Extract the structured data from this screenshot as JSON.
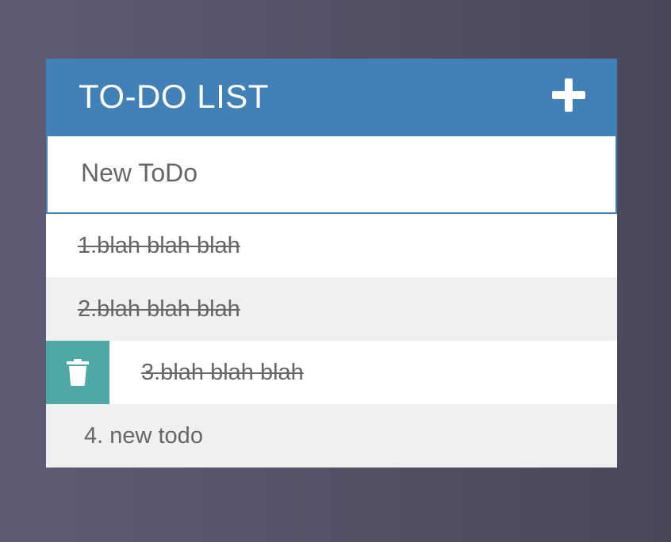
{
  "header": {
    "title": "TO-DO LIST",
    "add_icon": "plus-icon"
  },
  "new_todo": {
    "placeholder": "New ToDo",
    "value": ""
  },
  "todos": [
    {
      "text": "1.blah blah blah",
      "done": true,
      "delete_visible": false
    },
    {
      "text": "2.blah blah blah",
      "done": true,
      "delete_visible": false
    },
    {
      "text": "3.blah blah blah",
      "done": true,
      "delete_visible": true
    },
    {
      "text": "4. new todo",
      "done": false,
      "delete_visible": false
    }
  ],
  "delete_icon": "trash-icon",
  "colors": {
    "accent": "#4280b8",
    "delete": "#4ea8a6",
    "text": "#666666",
    "row_alt": "#f0f0f0"
  }
}
